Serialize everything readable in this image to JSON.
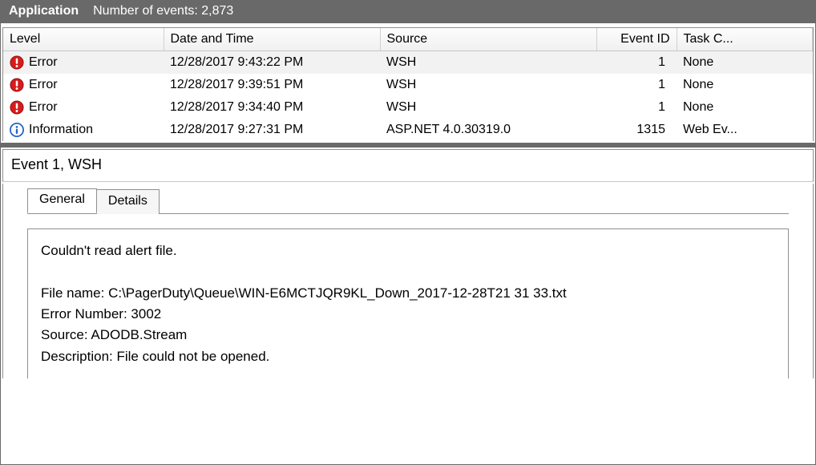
{
  "header": {
    "app": "Application",
    "events_label": "Number of events: 2,873"
  },
  "columns": {
    "level": "Level",
    "datetime": "Date and Time",
    "source": "Source",
    "event_id": "Event ID",
    "task": "Task C..."
  },
  "rows": [
    {
      "icon": "error",
      "level": "Error",
      "datetime": "12/28/2017 9:43:22 PM",
      "source": "WSH",
      "event_id": "1",
      "task": "None",
      "selected": true
    },
    {
      "icon": "error",
      "level": "Error",
      "datetime": "12/28/2017 9:39:51 PM",
      "source": "WSH",
      "event_id": "1",
      "task": "None",
      "selected": false
    },
    {
      "icon": "error",
      "level": "Error",
      "datetime": "12/28/2017 9:34:40 PM",
      "source": "WSH",
      "event_id": "1",
      "task": "None",
      "selected": false
    },
    {
      "icon": "info",
      "level": "Information",
      "datetime": "12/28/2017 9:27:31 PM",
      "source": "ASP.NET 4.0.30319.0",
      "event_id": "1315",
      "task": "Web Ev...",
      "selected": false
    }
  ],
  "detail": {
    "title": "Event 1, WSH",
    "tabs": {
      "general": "General",
      "details": "Details"
    },
    "message": "Couldn't read alert file.\n\nFile name: C:\\PagerDuty\\Queue\\WIN-E6MCTJQR9KL_Down_2017-12-28T21 31 33.txt\nError Number: 3002\nSource: ADODB.Stream\nDescription: File could not be opened."
  }
}
